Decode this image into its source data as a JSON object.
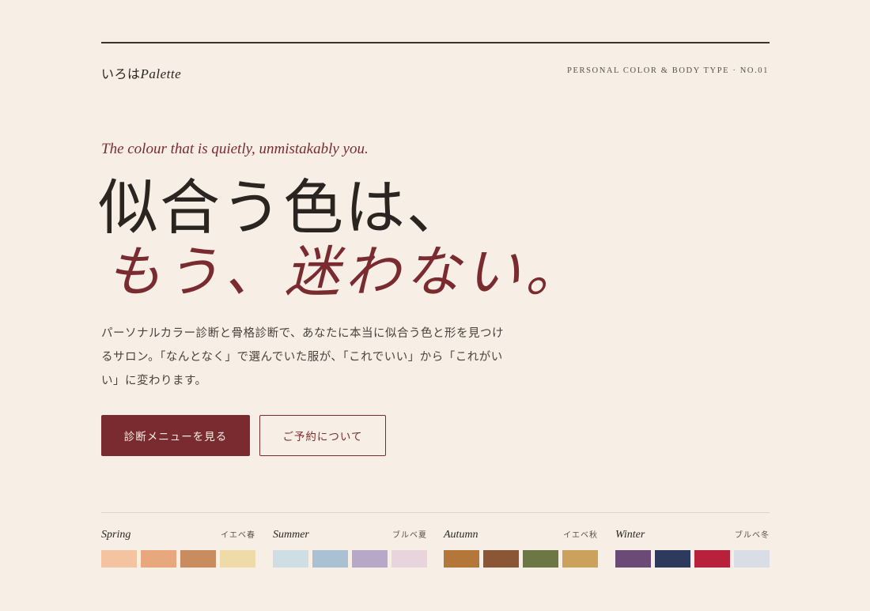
{
  "header": {
    "brand_jp": "いろは",
    "brand_latin": "Palette",
    "kicker": "PERSONAL COLOR & BODY TYPE · NO.01"
  },
  "hero": {
    "tagline": "The colour that is quietly, unmistakably you.",
    "headline_line1": "似合う色は、",
    "headline_line2": "もう、迷わない。",
    "lead": "パーソナルカラー診断と骨格診断で、あなたに本当に似合う色と形を見つけるサロン。「なんとなく」で選んでいた服が、「これでいい」から「これがいい」に変わります。"
  },
  "buttons": {
    "primary": "診断メニューを見る",
    "secondary": "ご予約について"
  },
  "seasons": [
    {
      "name": "Spring",
      "jp": "イエベ春",
      "colors": [
        "#f4c4a0",
        "#e8a77d",
        "#c88c5e",
        "#eedba8"
      ]
    },
    {
      "name": "Summer",
      "jp": "ブルベ夏",
      "colors": [
        "#cfdde4",
        "#a9c1d3",
        "#b7a8c8",
        "#e8d4dc"
      ]
    },
    {
      "name": "Autumn",
      "jp": "イエベ秋",
      "colors": [
        "#b27739",
        "#8a5633",
        "#6b7845",
        "#cba25c"
      ]
    },
    {
      "name": "Winter",
      "jp": "ブルベ冬",
      "colors": [
        "#6b4a78",
        "#2d3a5d",
        "#b7213b",
        "#d8dde6"
      ]
    }
  ],
  "colors": {
    "background": "#f7efe5",
    "accent": "#7a2b30",
    "text": "#2b2521"
  }
}
